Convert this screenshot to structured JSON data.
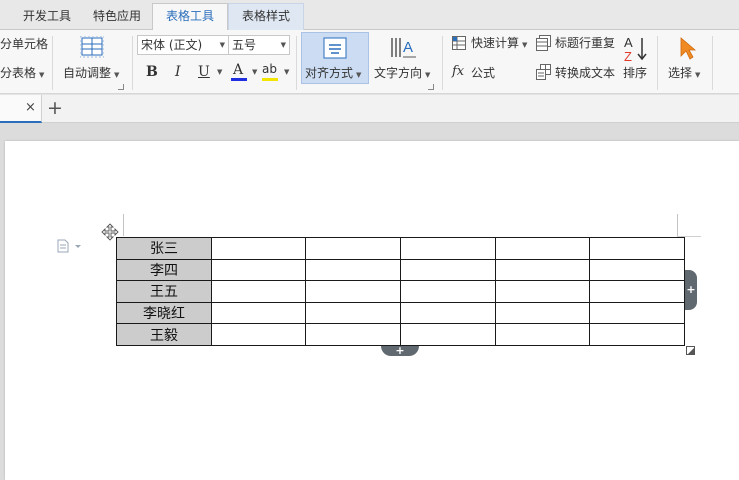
{
  "tabs": [
    {
      "label": "开发工具"
    },
    {
      "label": "特色应用"
    },
    {
      "label": "表格工具"
    },
    {
      "label": "表格样式"
    }
  ],
  "ribbon": {
    "split_cells": "分单元格",
    "split_table": "分表格",
    "autofit": "自动调整",
    "font_name": "宋体 (正文)",
    "font_size": "五号",
    "bold": "B",
    "italic": "I",
    "underline": "U",
    "font_color_glyph": "A",
    "highlight_glyph": "ab",
    "align": "对齐方式",
    "text_direction": "文字方向",
    "quick_calc": "快速计算",
    "formula": "公式",
    "fx_glyph": "fx",
    "title_row_repeat": "标题行重复",
    "convert_to_text": "转换成文本",
    "sort": "排序",
    "select": "选择"
  },
  "doc_tab": {
    "close_glyph": "×",
    "new_tab_glyph": "+"
  },
  "table": {
    "rows": [
      [
        "张三",
        "",
        "",
        "",
        "",
        ""
      ],
      [
        "李四",
        "",
        "",
        "",
        "",
        ""
      ],
      [
        "王五",
        "",
        "",
        "",
        "",
        ""
      ],
      [
        "李晓红",
        "",
        "",
        "",
        "",
        ""
      ],
      [
        "王毅",
        "",
        "",
        "",
        "",
        ""
      ]
    ],
    "add_glyph": "+"
  },
  "colors": {
    "accent": "#2a6ebc",
    "name_cell_bg": "#cccccc",
    "font_color_bar": "#1f2fe0",
    "highlight_bar": "#f2e600",
    "cursor_orange": "#f08a24",
    "sort_red": "#e03a2f"
  }
}
